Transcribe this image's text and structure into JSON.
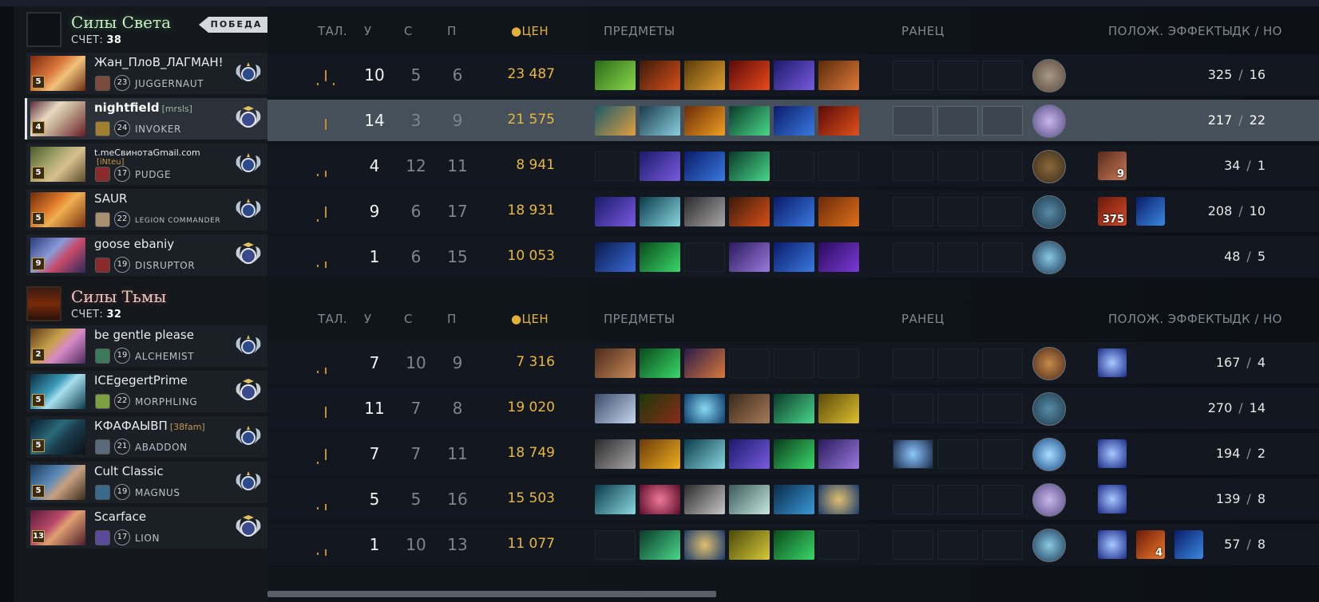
{
  "colors": {
    "gold": "#e8b83a",
    "radiant": "#c8f0c4",
    "dire": "#f0c8c4",
    "accent": "#c78b2a"
  },
  "headers": {
    "talents": "ТАЛ.",
    "kills": "У",
    "deaths": "С",
    "assists": "П",
    "networth": "ЦЕН",
    "items": "ПРЕДМЕТЫ",
    "backpack": "РАНЕЦ",
    "buffs": "ПОЛОЖ. ЭФФЕКТЫ",
    "lhdn": "ДК  /  НО"
  },
  "radiant": {
    "name": "Силы Света",
    "score_label": "СЧЕТ:",
    "score": "38",
    "victory": "ПОБЕДА",
    "players": [
      {
        "level": "5",
        "name": "Жан_ПлоВ_ЛАГМАН!",
        "tag": "",
        "hero_level": "23",
        "hero": "JUGGERNAUT",
        "k": "10",
        "d": "5",
        "a": "6",
        "nw": "23 487",
        "lh": "325",
        "dn": "16"
      },
      {
        "level": "4",
        "name": "nightfield",
        "tag": "[mrsls]",
        "hero_level": "24",
        "hero": "INVOKER",
        "k": "14",
        "d": "3",
        "a": "9",
        "nw": "21 575",
        "lh": "217",
        "dn": "22"
      },
      {
        "level": "5",
        "name": "t.meСвинотаGmail.com",
        "tag": "[iNteu]",
        "hero_level": "17",
        "hero": "PUDGE",
        "k": "4",
        "d": "12",
        "a": "11",
        "nw": "8 941",
        "lh": "34",
        "dn": "1",
        "buff1": "9"
      },
      {
        "level": "5",
        "name": "SAUR",
        "tag": "",
        "hero_level": "22",
        "hero": "LEGION COMMANDER",
        "k": "9",
        "d": "6",
        "a": "17",
        "nw": "18 931",
        "lh": "208",
        "dn": "10",
        "buff1": "375"
      },
      {
        "level": "9",
        "name": "goose ebaniy",
        "tag": "",
        "hero_level": "19",
        "hero": "DISRUPTOR",
        "k": "1",
        "d": "6",
        "a": "15",
        "nw": "10 053",
        "lh": "48",
        "dn": "5"
      }
    ]
  },
  "dire": {
    "name": "Силы Тьмы",
    "score_label": "СЧЕТ:",
    "score": "32",
    "players": [
      {
        "level": "2",
        "name": "be gentle please",
        "tag": "",
        "hero_level": "19",
        "hero": "ALCHEMIST",
        "k": "7",
        "d": "10",
        "a": "9",
        "nw": "7 316",
        "lh": "167",
        "dn": "4"
      },
      {
        "level": "5",
        "name": "ICEgegertPrime",
        "tag": "",
        "hero_level": "22",
        "hero": "MORPHLING",
        "k": "11",
        "d": "7",
        "a": "8",
        "nw": "19 020",
        "lh": "270",
        "dn": "14"
      },
      {
        "level": "5",
        "name": "КФАФАЫВП",
        "tag": "[38fam]",
        "hero_level": "21",
        "hero": "ABADDON",
        "k": "7",
        "d": "7",
        "a": "11",
        "nw": "18 749",
        "lh": "194",
        "dn": "2"
      },
      {
        "level": "5",
        "name": "Cult Classic",
        "tag": "",
        "hero_level": "19",
        "hero": "MAGNUS",
        "k": "5",
        "d": "5",
        "a": "16",
        "nw": "15 503",
        "lh": "139",
        "dn": "8"
      },
      {
        "level": "13",
        "name": "Scarface",
        "tag": "",
        "hero_level": "17",
        "hero": "LION",
        "k": "1",
        "d": "10",
        "a": "13",
        "nw": "11 077",
        "lh": "57",
        "dn": "8",
        "buff2": "4"
      }
    ]
  }
}
